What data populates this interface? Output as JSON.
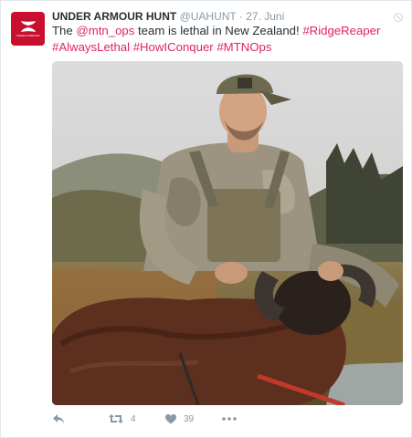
{
  "tweet": {
    "author_name": "UNDER ARMOUR HUNT",
    "handle": "@UAHUNT",
    "separator": "·",
    "time": "27. Juni",
    "text": {
      "part1": "The ",
      "mention": "@mtn_ops",
      "part2": " team is lethal in New Zealand! ",
      "tags_line1": "#RidgeReaper",
      "tags_line2": "#AlwaysLethal #HowIConquer #MTNOps"
    },
    "avatar_caption": "UNDER ARMOUR"
  },
  "actions": {
    "reply_icon": "reply-icon",
    "retweet_icon": "retweet-icon",
    "retweet_count": "4",
    "like_icon": "heart-icon",
    "like_count": "39",
    "more_icon": "more-icon"
  },
  "colors": {
    "accent": "#e0245e",
    "muted": "#8899a6",
    "brand": "#c8102e"
  }
}
